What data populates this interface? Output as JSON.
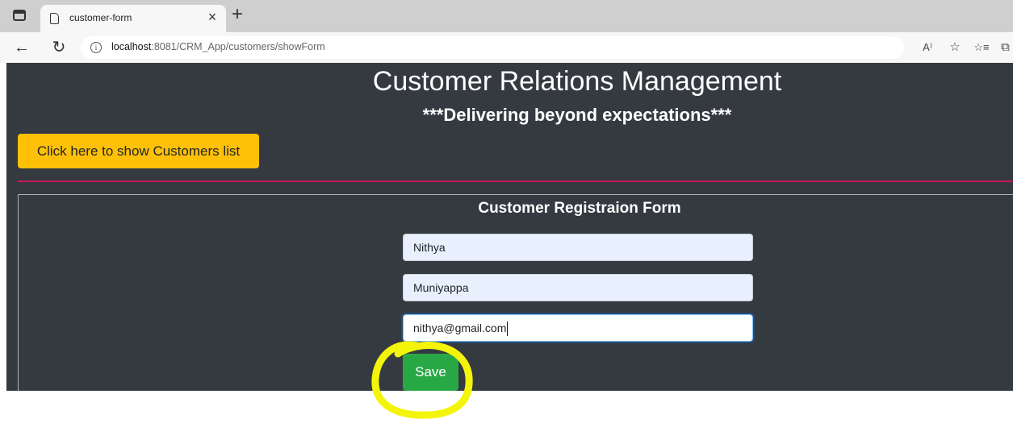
{
  "browser": {
    "tab_title": "customer-form",
    "tab_close": "×",
    "new_tab": "+",
    "url_host": "localhost",
    "url_rest": ":8081/CRM_App/customers/showForm",
    "read_aloud": "A⁾",
    "add_favorite": "☆",
    "favorites": "☆≡",
    "collections": "⧉"
  },
  "header": {
    "title": "Customer Relations Management",
    "tagline": "***Delivering beyond expectations***",
    "list_button": "Click here to show Customers list"
  },
  "form": {
    "title": "Customer Registraion Form",
    "first_name": "Nithya",
    "last_name": "Muniyappa",
    "email": "nithya@gmail.com",
    "save_label": "Save"
  },
  "colors": {
    "page_bg": "#343a40",
    "warning": "#ffc107",
    "success": "#28a745",
    "divider": "#c2185b",
    "highlight": "#f4f40a"
  }
}
